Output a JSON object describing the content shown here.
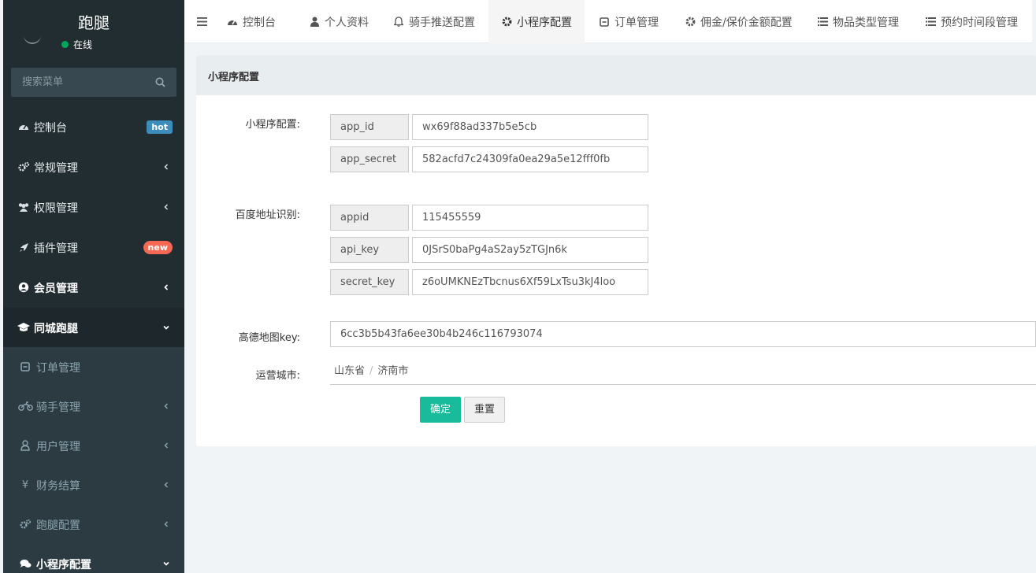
{
  "app": {
    "title": "跑腿"
  },
  "user": {
    "status": "在线",
    "status_color": "#00a65a"
  },
  "search": {
    "placeholder": "搜索菜单"
  },
  "sidebar": {
    "items": [
      {
        "label": "控制台",
        "icon": "dashboard-icon",
        "badge": "hot",
        "badge_color": "#3c8dbc"
      },
      {
        "label": "常规管理",
        "icon": "cogs-icon"
      },
      {
        "label": "权限管理",
        "icon": "users-icon"
      },
      {
        "label": "插件管理",
        "icon": "rocket-icon",
        "badge": "new",
        "badge_color": "#f56954"
      },
      {
        "label": "会员管理",
        "icon": "user-circle-icon"
      },
      {
        "label": "同城跑腿",
        "icon": "graduation-cap-icon"
      },
      {
        "label": "订单管理",
        "icon": "order-icon"
      },
      {
        "label": "骑手管理",
        "icon": "motorcycle-icon"
      },
      {
        "label": "用户管理",
        "icon": "user-icon"
      },
      {
        "label": "财务结算",
        "icon": "yen-icon"
      },
      {
        "label": "跑腿配置",
        "icon": "cogs-icon"
      },
      {
        "label": "小程序配置",
        "icon": "comments-icon"
      }
    ]
  },
  "tabs": [
    {
      "label": "控制台",
      "icon": "dashboard-icon"
    },
    {
      "label": "个人资料",
      "icon": "user-icon"
    },
    {
      "label": "骑手推送配置",
      "icon": "bell-icon"
    },
    {
      "label": "小程序配置",
      "icon": "gear-icon",
      "active": true
    },
    {
      "label": "订单管理",
      "icon": "order-icon"
    },
    {
      "label": "佣金/保价金额配置",
      "icon": "gear-icon"
    },
    {
      "label": "物品类型管理",
      "icon": "list-icon"
    },
    {
      "label": "预约时间段管理",
      "icon": "list-icon"
    }
  ],
  "panel": {
    "title": "小程序配置",
    "miniprogram": {
      "label": "小程序配置:",
      "fields": [
        {
          "key": "app_id",
          "value": "wx69f88ad337b5e5cb"
        },
        {
          "key": "app_secret",
          "value": "582acfd7c24309fa0ea29a5e12fff0fb"
        }
      ]
    },
    "baidu": {
      "label": "百度地址识别:",
      "fields": [
        {
          "key": "appid",
          "value": "115455559"
        },
        {
          "key": "api_key",
          "value": "0JSrS0baPg4aS2ay5zTGJn6k"
        },
        {
          "key": "secret_key",
          "value": "z6oUMKNEzTbcnus6Xf59LxTsu3kJ4loo"
        }
      ]
    },
    "amap": {
      "label": "高德地图key:",
      "value": "6cc3b5b43fa6ee30b4b246c116793074"
    },
    "city": {
      "label": "运营城市:",
      "province": "山东省",
      "separator": "/",
      "city": "济南市"
    },
    "buttons": {
      "ok": "确定",
      "reset": "重置"
    },
    "accent_color": "#18bc9c"
  }
}
